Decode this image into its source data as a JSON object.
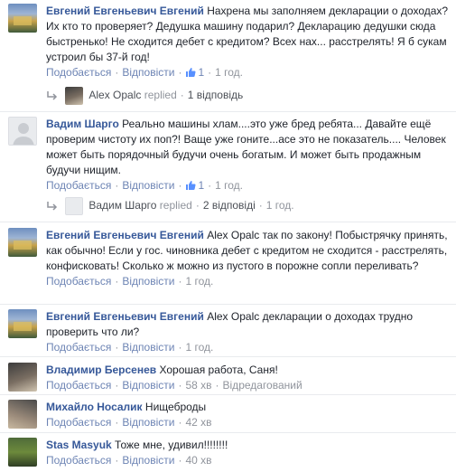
{
  "labels": {
    "like": "Подобається",
    "reply": "Відповісти",
    "replied": "replied",
    "edited": "Відредагований"
  },
  "comments": [
    {
      "author": "Евгений Евгеньевич Евгений",
      "text": "Нахрена мы заполняем декларации о доходах? Их кто то проверяет? Дедушка машину подарил? Декларацию дедушки сюда быстренько! Не сходится дебет с кредитом? Всех нах... расстрелять! Я б сукам устроил бы 37-й год!",
      "likes": "1",
      "time": "1 год.",
      "reply_author": "Alex Opalc",
      "reply_count": "1 відповідь"
    },
    {
      "author": "Вадим Шарго",
      "text": "Реально машины хлам....это уже бред ребята... Давайте ещё проверим чистоту их поп?! Ваще уже гоните...асе это не показатель.... Человек может быть порядочный будучи очень богатым. И может быть продажным будучи нищим.",
      "likes": "1",
      "time": "1 год.",
      "reply_author": "Вадим Шарго",
      "reply_count": "2 відповіді",
      "reply_time": "1 год."
    },
    {
      "author": "Евгений Евгеньевич Евгений",
      "text": "Alex Opalc так по закону! Побыстрячку принять, как обычно! Если у гос. чиновника дебет с кредитом не сходится - расстрелять, конфисковать! Сколько ж можно из пустого в порожне сопли переливать?",
      "time": "1 год."
    },
    {
      "author": "Евгений Евгеньевич Евгений",
      "text": "Alex Opalc декларации о доходах трудно проверить что ли?",
      "time": "1 год."
    },
    {
      "author": "Владимир Берсенев",
      "text": "Хорошая работа, Саня!",
      "time": "58 хв"
    },
    {
      "author": "Михайло Носалик",
      "text": "Нищеброды",
      "time": "42 хв"
    },
    {
      "author": "Stas Masyuk",
      "text": "Тоже мне, удивил!!!!!!!!",
      "time": "40 хв"
    }
  ]
}
